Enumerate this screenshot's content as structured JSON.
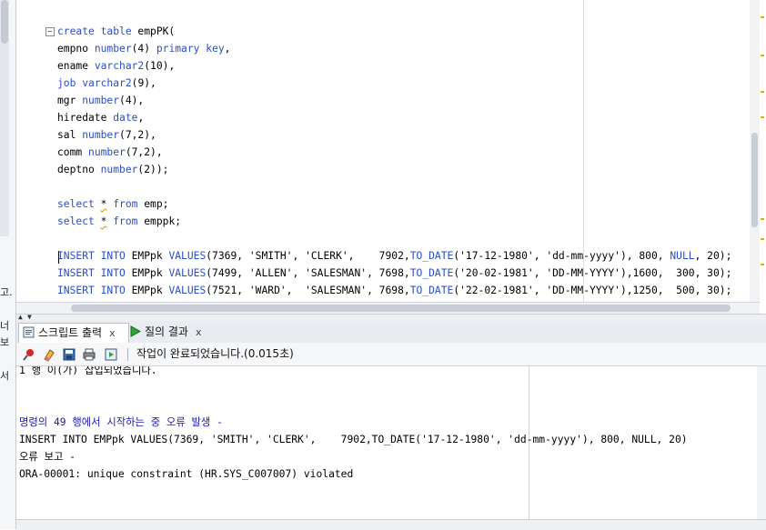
{
  "left_panel": {
    "glyphs": [
      "고.",
      "너",
      "보",
      "서"
    ]
  },
  "editor": {
    "lines": [
      {
        "segments": [
          {
            "t": "create table ",
            "c": "kw"
          },
          {
            "t": "empPK(",
            "c": ""
          }
        ]
      },
      {
        "segments": [
          {
            "t": "empno ",
            "c": ""
          },
          {
            "t": "number",
            "c": "kw"
          },
          {
            "t": "(4) ",
            "c": ""
          },
          {
            "t": "primary key",
            "c": "kw"
          },
          {
            "t": ",",
            "c": ""
          }
        ]
      },
      {
        "segments": [
          {
            "t": "ename ",
            "c": ""
          },
          {
            "t": "varchar2",
            "c": "kw"
          },
          {
            "t": "(10),",
            "c": ""
          }
        ]
      },
      {
        "segments": [
          {
            "t": "job ",
            "c": "kw"
          },
          {
            "t": "varchar2",
            "c": "kw"
          },
          {
            "t": "(9),",
            "c": ""
          }
        ]
      },
      {
        "segments": [
          {
            "t": "mgr ",
            "c": ""
          },
          {
            "t": "number",
            "c": "kw"
          },
          {
            "t": "(4),",
            "c": ""
          }
        ]
      },
      {
        "segments": [
          {
            "t": "hiredate ",
            "c": ""
          },
          {
            "t": "date",
            "c": "kw"
          },
          {
            "t": ",",
            "c": ""
          }
        ]
      },
      {
        "segments": [
          {
            "t": "sal ",
            "c": ""
          },
          {
            "t": "number",
            "c": "kw"
          },
          {
            "t": "(7,2),",
            "c": ""
          }
        ]
      },
      {
        "segments": [
          {
            "t": "comm ",
            "c": ""
          },
          {
            "t": "number",
            "c": "kw"
          },
          {
            "t": "(7,2),",
            "c": ""
          }
        ]
      },
      {
        "segments": [
          {
            "t": "deptno ",
            "c": ""
          },
          {
            "t": "number",
            "c": "kw"
          },
          {
            "t": "(2));",
            "c": ""
          }
        ]
      },
      {
        "segments": []
      },
      {
        "segments": [
          {
            "t": "select ",
            "c": "kw"
          },
          {
            "t": "*",
            "c": "wavy"
          },
          {
            "t": " ",
            "c": ""
          },
          {
            "t": "from",
            "c": "kw"
          },
          {
            "t": " emp;",
            "c": ""
          }
        ]
      },
      {
        "segments": [
          {
            "t": "select ",
            "c": "kw"
          },
          {
            "t": "*",
            "c": "wavy"
          },
          {
            "t": " ",
            "c": ""
          },
          {
            "t": "from",
            "c": "kw"
          },
          {
            "t": " emppk;",
            "c": ""
          }
        ]
      },
      {
        "segments": []
      },
      {
        "segments": [
          {
            "t": "INSERT INTO ",
            "c": "kw"
          },
          {
            "t": "EMPpk ",
            "c": ""
          },
          {
            "t": "VALUES",
            "c": "kw"
          },
          {
            "t": "(7369, 'SMITH', 'CLERK',    7902,",
            "c": ""
          },
          {
            "t": "TO_DATE",
            "c": "kw"
          },
          {
            "t": "('17-12-1980', 'dd-mm-yyyy'), 800, ",
            "c": ""
          },
          {
            "t": "NULL",
            "c": "kw"
          },
          {
            "t": ", 20);",
            "c": ""
          }
        ]
      },
      {
        "segments": [
          {
            "t": "INSERT INTO ",
            "c": "kw"
          },
          {
            "t": "EMPpk ",
            "c": ""
          },
          {
            "t": "VALUES",
            "c": "kw"
          },
          {
            "t": "(7499, 'ALLEN', 'SALESMAN', 7698,",
            "c": ""
          },
          {
            "t": "TO_DATE",
            "c": "kw"
          },
          {
            "t": "('20-02-1981', 'DD-MM-YYYY'),1600,  300, 30);",
            "c": ""
          }
        ]
      },
      {
        "segments": [
          {
            "t": "INSERT INTO ",
            "c": "kw"
          },
          {
            "t": "EMPpk ",
            "c": ""
          },
          {
            "t": "VALUES",
            "c": "kw"
          },
          {
            "t": "(7521, 'WARD',  'SALESMAN', 7698,",
            "c": ""
          },
          {
            "t": "TO_DATE",
            "c": "kw"
          },
          {
            "t": "('22-02-1981', 'DD-MM-YYYY'),1250,  500, 30);",
            "c": ""
          }
        ]
      }
    ]
  },
  "tabs": {
    "script_output": "스크립트 출력",
    "query_result": "질의 결과",
    "close": "x"
  },
  "toolbar": {
    "status": "작업이 완료되었습니다.(0.015초)"
  },
  "output": {
    "lines": [
      {
        "text": "1 행 이(가) 삽입되었습니다.",
        "c": ""
      },
      {
        "text": "",
        "c": ""
      },
      {
        "text": "",
        "c": ""
      },
      {
        "text": "명령의 49 행에서 시작하는 중 오류 발생 -",
        "c": "blue"
      },
      {
        "text": "INSERT INTO EMPpk VALUES(7369, 'SMITH', 'CLERK',    7902,TO_DATE('17-12-1980', 'dd-mm-yyyy'), 800, NULL, 20)",
        "c": ""
      },
      {
        "text": "오류 보고 -",
        "c": ""
      },
      {
        "text": "ORA-00001: unique constraint (HR.SYS_C007007) violated",
        "c": ""
      }
    ]
  },
  "colors": {
    "keyword": "#2a4ec9",
    "error_header": "#1a1ab0",
    "warning_mark": "#e0b000"
  }
}
